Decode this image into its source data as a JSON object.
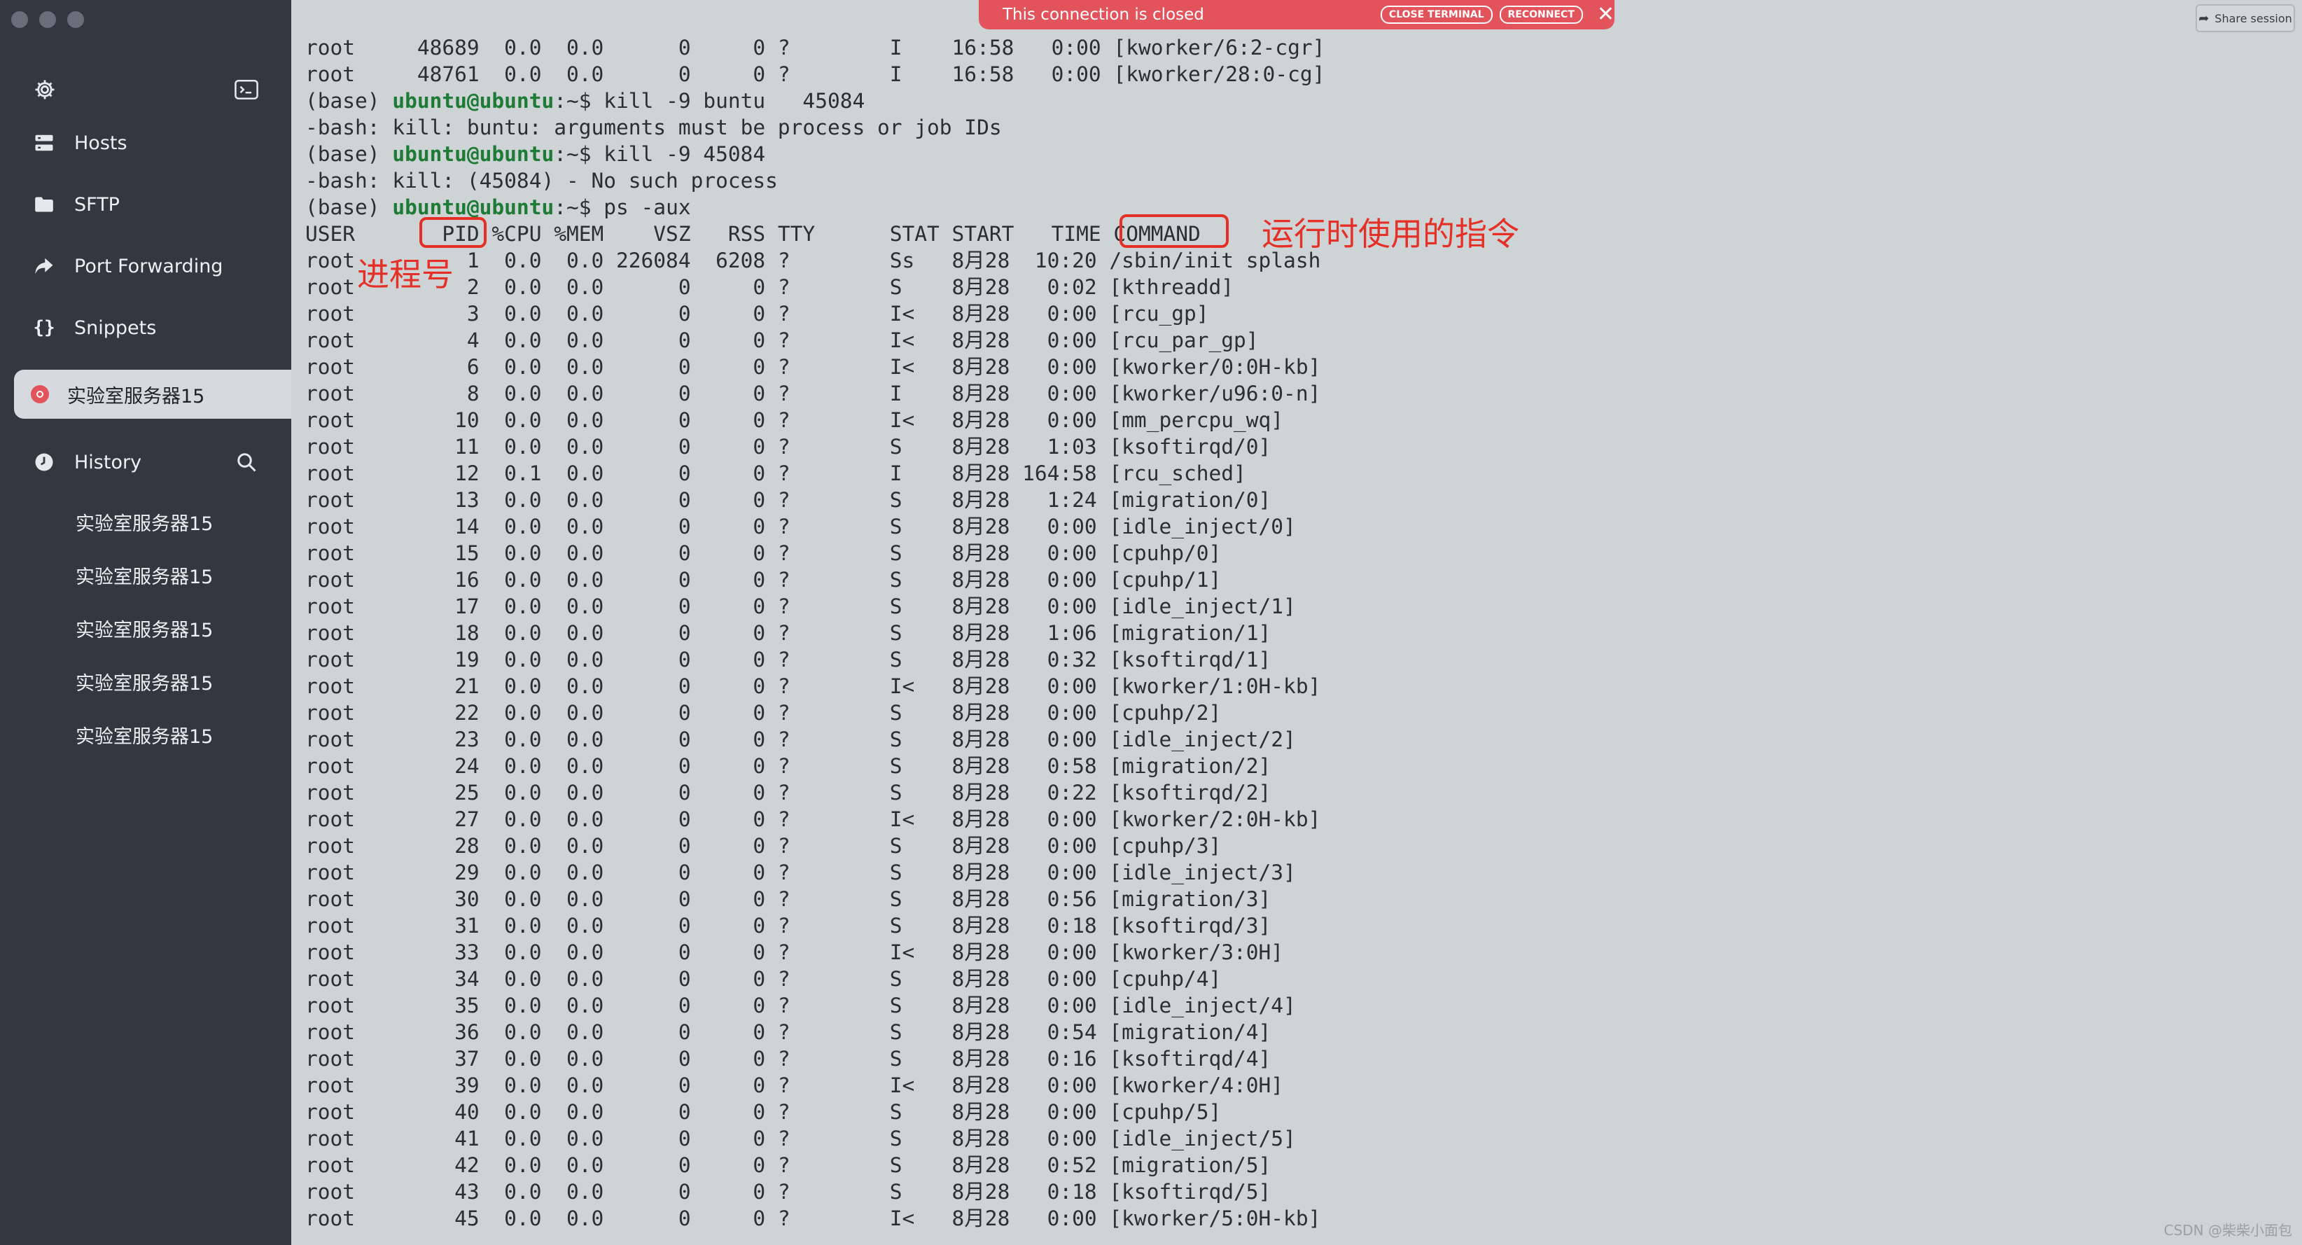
{
  "sidebar": {
    "window_controls": [
      "close",
      "minimize",
      "zoom"
    ],
    "nav": [
      {
        "label": "Hosts",
        "icon": "hosts-icon"
      },
      {
        "label": "SFTP",
        "icon": "folder-icon"
      },
      {
        "label": "Port Forwarding",
        "icon": "port-forwarding-icon"
      },
      {
        "label": "Snippets",
        "icon": "snippets-icon"
      }
    ],
    "active_session": "实验室服务器15",
    "history_label": "History",
    "history_items": [
      "实验室服务器15",
      "实验室服务器15",
      "实验室服务器15",
      "实验室服务器15",
      "实验室服务器15"
    ]
  },
  "banner": {
    "message": "This connection is closed",
    "close_terminal": "CLOSE TERMINAL",
    "reconnect": "RECONNECT",
    "close_glyph": "✕"
  },
  "share_label": "Share session",
  "terminal": {
    "prompt": {
      "prefix": "(base) ",
      "user_host": "ubuntu@ubuntu",
      "path": ":~$ "
    },
    "lines": [
      {
        "text": "root     48689  0.0  0.0      0     0 ?        I    16:58   0:00 [kworker/6:2-cgr]"
      },
      {
        "text": "root     48761  0.0  0.0      0     0 ?        I    16:58   0:00 [kworker/28:0-cg]"
      },
      {
        "prompt": true,
        "text": "kill -9 buntu   45084"
      },
      {
        "text": "-bash: kill: buntu: arguments must be process or job IDs"
      },
      {
        "prompt": true,
        "text": "kill -9 45084"
      },
      {
        "text": "-bash: kill: (45084) - No such process"
      },
      {
        "prompt": true,
        "text": "ps -aux"
      },
      {
        "text": "USER       PID %CPU %MEM    VSZ   RSS TTY      STAT START   TIME COMMAND"
      },
      {
        "text": "root         1  0.0  0.0 226084  6208 ?        Ss   8月28  10:20 /sbin/init splash"
      },
      {
        "text": "root         2  0.0  0.0      0     0 ?        S    8月28   0:02 [kthreadd]"
      },
      {
        "text": "root         3  0.0  0.0      0     0 ?        I<   8月28   0:00 [rcu_gp]"
      },
      {
        "text": "root         4  0.0  0.0      0     0 ?        I<   8月28   0:00 [rcu_par_gp]"
      },
      {
        "text": "root         6  0.0  0.0      0     0 ?        I<   8月28   0:00 [kworker/0:0H-kb]"
      },
      {
        "text": "root         8  0.0  0.0      0     0 ?        I    8月28   0:00 [kworker/u96:0-n]"
      },
      {
        "text": "root        10  0.0  0.0      0     0 ?        I<   8月28   0:00 [mm_percpu_wq]"
      },
      {
        "text": "root        11  0.0  0.0      0     0 ?        S    8月28   1:03 [ksoftirqd/0]"
      },
      {
        "text": "root        12  0.1  0.0      0     0 ?        I    8月28 164:58 [rcu_sched]"
      },
      {
        "text": "root        13  0.0  0.0      0     0 ?        S    8月28   1:24 [migration/0]"
      },
      {
        "text": "root        14  0.0  0.0      0     0 ?        S    8月28   0:00 [idle_inject/0]"
      },
      {
        "text": "root        15  0.0  0.0      0     0 ?        S    8月28   0:00 [cpuhp/0]"
      },
      {
        "text": "root        16  0.0  0.0      0     0 ?        S    8月28   0:00 [cpuhp/1]"
      },
      {
        "text": "root        17  0.0  0.0      0     0 ?        S    8月28   0:00 [idle_inject/1]"
      },
      {
        "text": "root        18  0.0  0.0      0     0 ?        S    8月28   1:06 [migration/1]"
      },
      {
        "text": "root        19  0.0  0.0      0     0 ?        S    8月28   0:32 [ksoftirqd/1]"
      },
      {
        "text": "root        21  0.0  0.0      0     0 ?        I<   8月28   0:00 [kworker/1:0H-kb]"
      },
      {
        "text": "root        22  0.0  0.0      0     0 ?        S    8月28   0:00 [cpuhp/2]"
      },
      {
        "text": "root        23  0.0  0.0      0     0 ?        S    8月28   0:00 [idle_inject/2]"
      },
      {
        "text": "root        24  0.0  0.0      0     0 ?        S    8月28   0:58 [migration/2]"
      },
      {
        "text": "root        25  0.0  0.0      0     0 ?        S    8月28   0:22 [ksoftirqd/2]"
      },
      {
        "text": "root        27  0.0  0.0      0     0 ?        I<   8月28   0:00 [kworker/2:0H-kb]"
      },
      {
        "text": "root        28  0.0  0.0      0     0 ?        S    8月28   0:00 [cpuhp/3]"
      },
      {
        "text": "root        29  0.0  0.0      0     0 ?        S    8月28   0:00 [idle_inject/3]"
      },
      {
        "text": "root        30  0.0  0.0      0     0 ?        S    8月28   0:56 [migration/3]"
      },
      {
        "text": "root        31  0.0  0.0      0     0 ?        S    8月28   0:18 [ksoftirqd/3]"
      },
      {
        "text": "root        33  0.0  0.0      0     0 ?        I<   8月28   0:00 [kworker/3:0H]"
      },
      {
        "text": "root        34  0.0  0.0      0     0 ?        S    8月28   0:00 [cpuhp/4]"
      },
      {
        "text": "root        35  0.0  0.0      0     0 ?        S    8月28   0:00 [idle_inject/4]"
      },
      {
        "text": "root        36  0.0  0.0      0     0 ?        S    8月28   0:54 [migration/4]"
      },
      {
        "text": "root        37  0.0  0.0      0     0 ?        S    8月28   0:16 [ksoftirqd/4]"
      },
      {
        "text": "root        39  0.0  0.0      0     0 ?        I<   8月28   0:00 [kworker/4:0H]"
      },
      {
        "text": "root        40  0.0  0.0      0     0 ?        S    8月28   0:00 [cpuhp/5]"
      },
      {
        "text": "root        41  0.0  0.0      0     0 ?        S    8月28   0:00 [idle_inject/5]"
      },
      {
        "text": "root        42  0.0  0.0      0     0 ?        S    8月28   0:52 [migration/5]"
      },
      {
        "text": "root        43  0.0  0.0      0     0 ?        S    8月28   0:18 [ksoftirqd/5]"
      },
      {
        "text": "root        45  0.0  0.0      0     0 ?        I<   8月28   0:00 [kworker/5:0H-kb]"
      }
    ]
  },
  "annotations": {
    "pid_label": "进程号",
    "command_label": "运行时使用的指令"
  },
  "watermark": "CSDN @柴柴小面包",
  "colors": {
    "sidebar_bg": "#343640",
    "terminal_bg": "#ced3d6",
    "banner_bg": "#e2535b",
    "prompt_green": "#1d7b35",
    "annotation_red": "#e53027"
  }
}
